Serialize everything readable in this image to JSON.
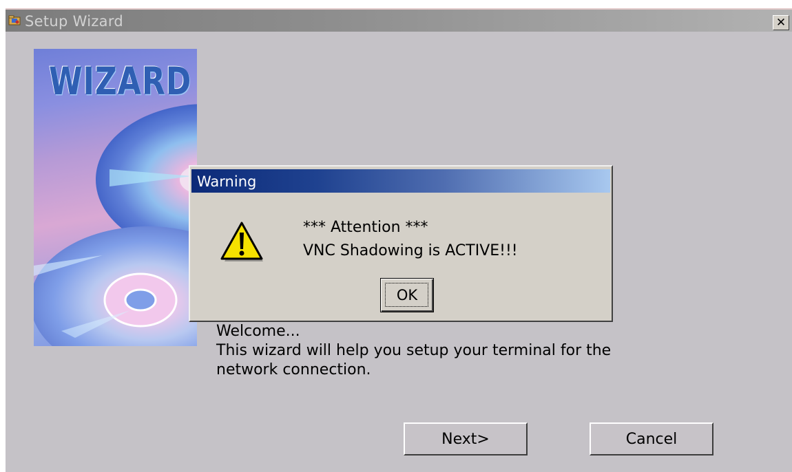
{
  "window": {
    "title": "Setup Wizard",
    "close_label": "✕"
  },
  "art": {
    "word": "WIZARD"
  },
  "welcome": {
    "line1": "Welcome...",
    "line2": "This wizard will help you setup your terminal for the",
    "line3": "network connection."
  },
  "buttons": {
    "next_label": "Next>",
    "cancel_label": "Cancel"
  },
  "dialog": {
    "title": "Warning",
    "message_line1": "*** Attention ***",
    "message_line2": "VNC Shadowing is ACTIVE!!!",
    "ok_label": "OK",
    "icon": "warning-icon"
  },
  "colors": {
    "window_bg": "#c5c2c7",
    "dialog_titlebar_start": "#0c2a78",
    "dialog_titlebar_end": "#a8c8ef",
    "warning_yellow": "#f5e100"
  }
}
